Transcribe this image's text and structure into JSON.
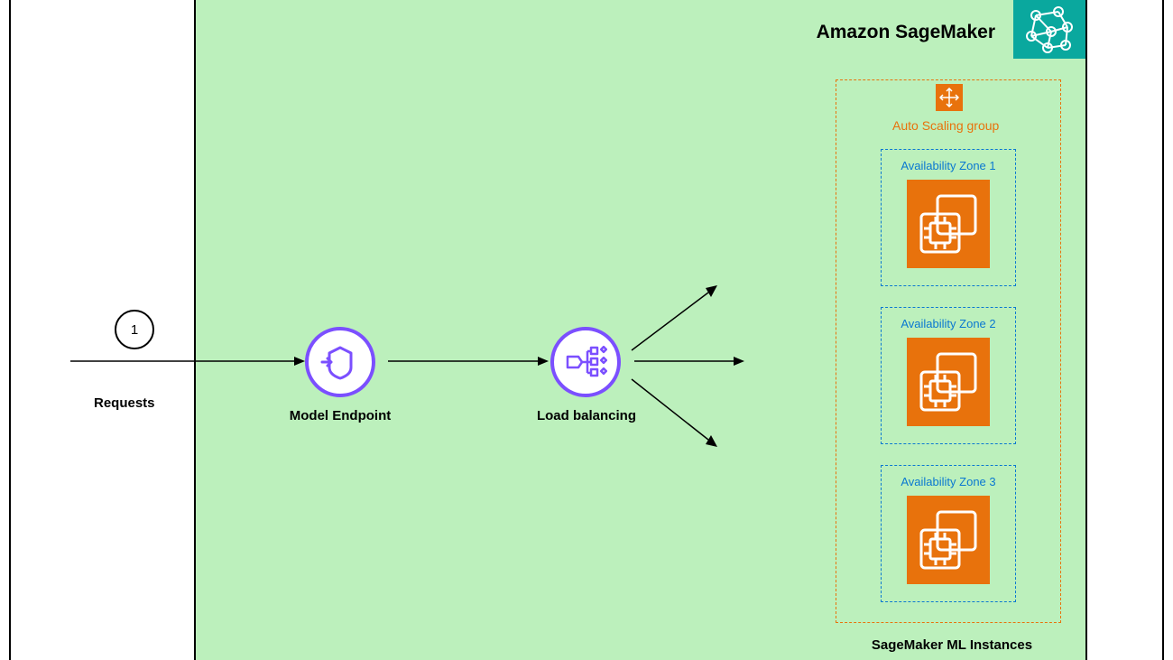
{
  "diagram": {
    "service_title": "Amazon SageMaker",
    "step_number": "1",
    "requests_label": "Requests",
    "model_endpoint_label": "Model Endpoint",
    "load_balancing_label": "Load balancing",
    "asg_label": "Auto Scaling group",
    "az1_label": "Availability Zone 1",
    "az2_label": "Availability Zone 2",
    "az3_label": "Availability Zone 3",
    "instances_caption": "SageMaker ML Instances"
  }
}
